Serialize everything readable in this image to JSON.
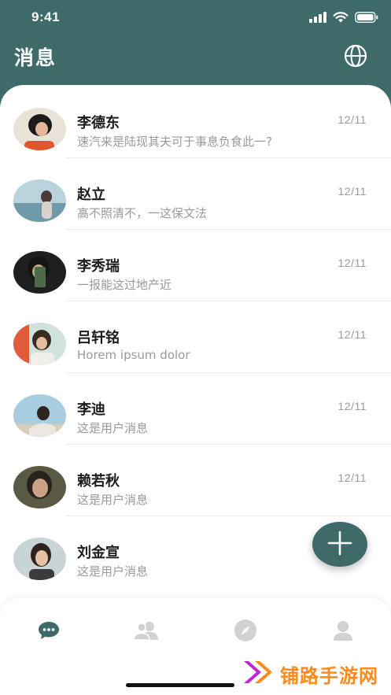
{
  "status_bar": {
    "time": "9:41"
  },
  "header": {
    "title": "消息"
  },
  "messages": [
    {
      "name": "李德东",
      "preview": "速汽来是陆现其夫可于事息负食此一?",
      "date": "12/11"
    },
    {
      "name": "赵立",
      "preview": "高不照清不，一这保文法",
      "date": "12/11"
    },
    {
      "name": "李秀瑞",
      "preview": "一报能这过地产近",
      "date": "12/11"
    },
    {
      "name": "吕轩铭",
      "preview": "Horem ipsum dolor",
      "date": "12/11"
    },
    {
      "name": "李迪",
      "preview": "这是用户消息",
      "date": "12/11"
    },
    {
      "name": "赖若秋",
      "preview": "这是用户消息",
      "date": "12/11"
    },
    {
      "name": "刘金宣",
      "preview": "这是用户消息",
      "date": ""
    }
  ],
  "tabs": [
    {
      "icon": "chat-bubble-icon",
      "active": true
    },
    {
      "icon": "contacts-icon",
      "active": false
    },
    {
      "icon": "compass-icon",
      "active": false
    },
    {
      "icon": "profile-icon",
      "active": false
    }
  ],
  "watermark": {
    "text": "铺路手游网"
  },
  "colors": {
    "primary": "#3f6a6a",
    "inactive_icon": "#d2d2d2",
    "watermark": "#ff8a1a"
  }
}
